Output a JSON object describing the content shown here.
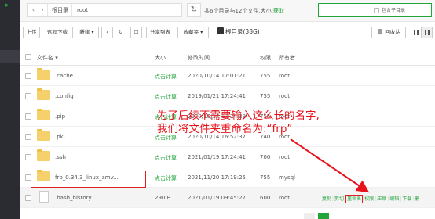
{
  "breadcrumb": {
    "root_label": "根目录",
    "current_label": "root"
  },
  "summary": {
    "text": "共6个目录与12个文件,大小:",
    "link": "获取"
  },
  "search": {
    "placeholder": "",
    "subdir_label": "包含子目录"
  },
  "toolbar": {
    "upload": "上传",
    "remote_download": "远程下载",
    "new": "新建 ▾",
    "share_list": "分享列表",
    "favorites": "收藏夹 ▾",
    "disk": "根目录(38G)",
    "recycle_bin": "回收站"
  },
  "table": {
    "headers": {
      "name": "文件名",
      "size": "大小",
      "mtime": "修改时间",
      "perm": "权限",
      "owner": "所有者"
    },
    "rows": [
      {
        "name": ".cache",
        "size": "点击计算",
        "mtime": "2020/10/14 17:01:21",
        "perm": "755",
        "owner": "root"
      },
      {
        "name": ".config",
        "size": "点击计算",
        "mtime": "2019/01/21 17:24:41",
        "perm": "755",
        "owner": "root"
      },
      {
        "name": ".pip",
        "size": "点击计算",
        "mtime": "2020/10/14 17:24:39",
        "perm": "755",
        "owner": "root"
      },
      {
        "name": ".pki",
        "size": "点击计算",
        "mtime": "2020/10/14 16:52:37",
        "perm": "740",
        "owner": "root"
      },
      {
        "name": ".ssh",
        "size": "点击计算",
        "mtime": "2021/01/19 17:24:41",
        "perm": "700",
        "owner": "root"
      },
      {
        "name": "frp_0.34.3_linux_amv...",
        "size": "点击计算",
        "mtime": "2021/11/20 17:19:25",
        "perm": "755",
        "owner": "mysql"
      },
      {
        "name": ".bash_history",
        "size": "290 B",
        "mtime": "2021/01/19 09:45:27",
        "perm": "600",
        "owner": "root"
      }
    ],
    "row_ops": [
      "复制",
      "剪切",
      "重命名",
      "权限",
      "压缩",
      "编辑",
      "下载",
      "删"
    ]
  },
  "annotation": {
    "line1": "为了后续不需要输入这么长的名字,",
    "line2": "我们将文件夹重命名为:“frp”"
  },
  "colors": {
    "accent": "#20a53a",
    "annotation": "#e8141c",
    "folder": "#f6d16b"
  },
  "icons": [
    "back-icon",
    "forward-icon",
    "refresh-icon",
    "disk-icon",
    "list-view-icon",
    "grid-view-icon",
    "folder-icon",
    "file-icon"
  ]
}
